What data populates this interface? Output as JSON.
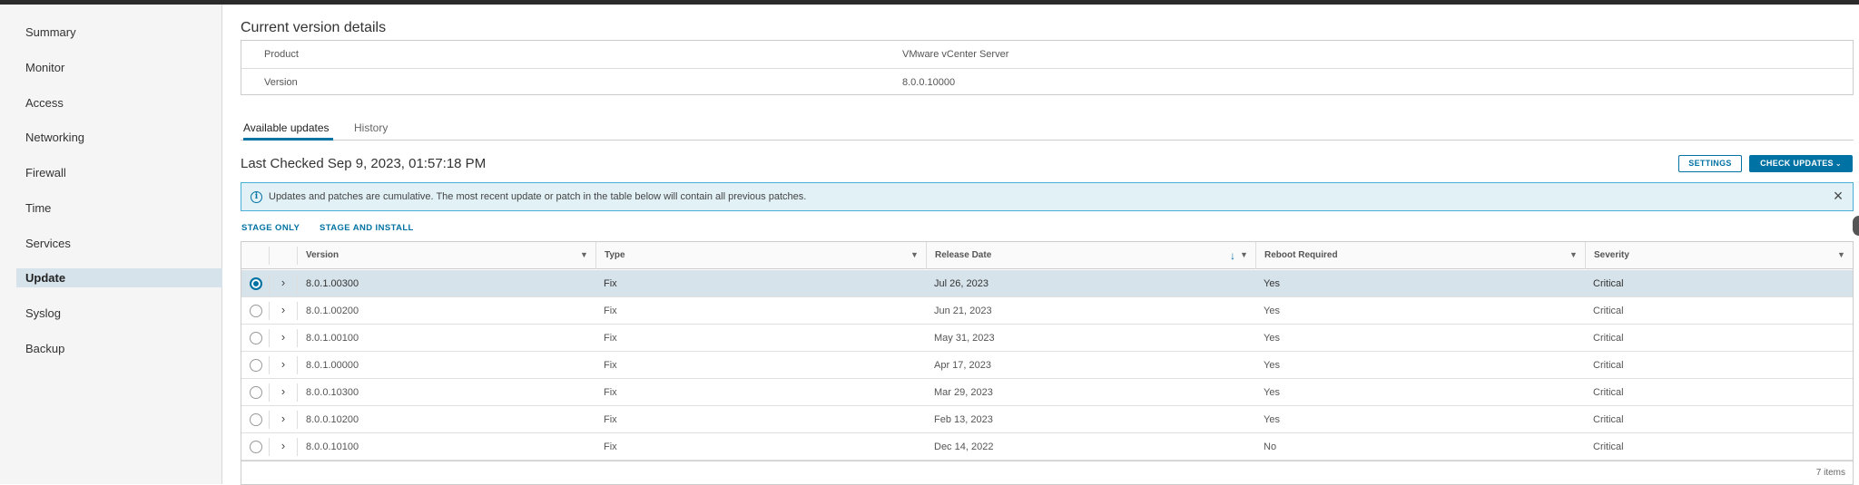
{
  "sidebar": {
    "items": [
      {
        "label": "Summary"
      },
      {
        "label": "Monitor"
      },
      {
        "label": "Access"
      },
      {
        "label": "Networking"
      },
      {
        "label": "Firewall"
      },
      {
        "label": "Time"
      },
      {
        "label": "Services"
      },
      {
        "label": "Update"
      },
      {
        "label": "Syslog"
      },
      {
        "label": "Backup"
      }
    ],
    "active": "Update"
  },
  "current_version": {
    "title": "Current version details",
    "product_label": "Product",
    "product_value": "VMware vCenter Server",
    "version_label": "Version",
    "version_value": "8.0.0.10000"
  },
  "tabs": [
    {
      "label": "Available updates",
      "active": true
    },
    {
      "label": "History",
      "active": false
    }
  ],
  "last_checked": "Last Checked Sep 9, 2023, 01:57:18 PM",
  "buttons": {
    "settings": "SETTINGS",
    "check_updates": "CHECK UPDATES"
  },
  "alert": {
    "text": "Updates and patches are cumulative. The most recent update or patch in the table below will contain all previous patches.",
    "icon": "info-icon",
    "close": "×"
  },
  "actions": {
    "stage_only": "STAGE ONLY",
    "stage_and_install": "STAGE AND INSTALL"
  },
  "grid": {
    "columns": {
      "version": "Version",
      "type": "Type",
      "release_date": "Release Date",
      "reboot_required": "Reboot Required",
      "severity": "Severity"
    },
    "sorted_column": "Release Date",
    "sort_direction": "descending",
    "rows": [
      {
        "version": "8.0.1.00300",
        "type": "Fix",
        "release_date": "Jul 26, 2023",
        "reboot": "Yes",
        "severity": "Critical",
        "selected": true
      },
      {
        "version": "8.0.1.00200",
        "type": "Fix",
        "release_date": "Jun 21, 2023",
        "reboot": "Yes",
        "severity": "Critical",
        "selected": false
      },
      {
        "version": "8.0.1.00100",
        "type": "Fix",
        "release_date": "May 31, 2023",
        "reboot": "Yes",
        "severity": "Critical",
        "selected": false
      },
      {
        "version": "8.0.1.00000",
        "type": "Fix",
        "release_date": "Apr 17, 2023",
        "reboot": "Yes",
        "severity": "Critical",
        "selected": false
      },
      {
        "version": "8.0.0.10300",
        "type": "Fix",
        "release_date": "Mar 29, 2023",
        "reboot": "Yes",
        "severity": "Critical",
        "selected": false
      },
      {
        "version": "8.0.0.10200",
        "type": "Fix",
        "release_date": "Feb 13, 2023",
        "reboot": "Yes",
        "severity": "Critical",
        "selected": false
      },
      {
        "version": "8.0.0.10100",
        "type": "Fix",
        "release_date": "Dec 14, 2022",
        "reboot": "No",
        "severity": "Critical",
        "selected": false
      }
    ],
    "footer": "7 items"
  },
  "colors": {
    "accent": "#0072a3",
    "selected_row": "#d6e3ea",
    "alert_bg": "#e1f1f6",
    "alert_border": "#49afd9"
  }
}
